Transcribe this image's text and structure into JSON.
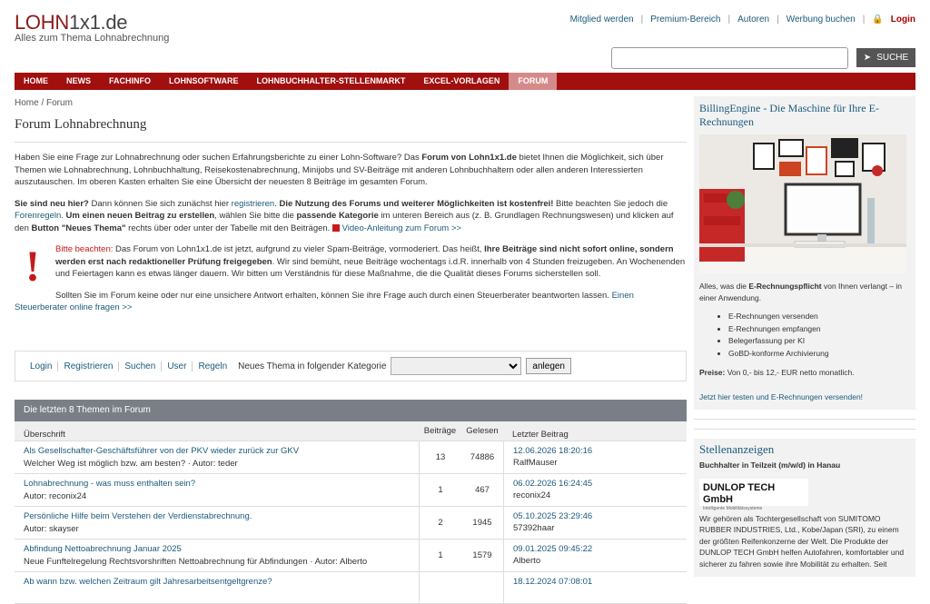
{
  "header": {
    "logo_a": "LOHN",
    "logo_b": "1x1.de",
    "tagline": "Alles zum Thema Lohnabrechnung",
    "links": [
      "Mitglied werden",
      "Premium-Bereich",
      "Autoren",
      "Werbung buchen"
    ],
    "login": "Login"
  },
  "search": {
    "button": "SUCHE",
    "placeholder": ""
  },
  "nav": [
    "HOME",
    "NEWS",
    "FACHINFO",
    "LOHNSOFTWARE",
    "LOHNBUCHHALTER-STELLENMARKT",
    "EXCEL-VORLAGEN",
    "FORUM"
  ],
  "breadcrumb": "Home / Forum",
  "page": {
    "title": "Forum Lohnabrechnung",
    "intro_a": "Haben Sie eine Frage zur Lohnabrechnung oder suchen Erfahrungsberichte zu einer Lohn-Software? Das ",
    "intro_b": "Forum von Lohn1x1.de",
    "intro_c": " bietet Ihnen die Möglichkeit, sich über Themen wie Lohnabrechnung, Lohnbuchhaltung, Reisekostenabrechnung, Minijobs und SV-Beiträge mit anderen Lohnbuchhaltern oder allen anderen Interessierten auszutauschen. Im oberen Kasten erhalten Sie eine Übersicht der neuesten 8 Beiträge im gesamten Forum.",
    "new_a": "Sie sind neu hier?",
    "new_b": " Dann können Sie sich zunächst hier ",
    "new_link": "registrieren",
    "new_c": ". ",
    "new_d": "Die Nutzung des Forums und weiterer Möglichkeiten ist kostenfrei!",
    "new_e": " Bitte beachten Sie jedoch die ",
    "new_rules": "Forenregeln",
    "new_f": ". ",
    "new_g": "Um einen neuen Beitrag zu erstellen",
    "new_h": ", wählen Sie bitte die ",
    "new_i": "passende Kategorie",
    "new_j": " im unteren Bereich aus (z. B. Grundlagen Rechnungswesen) und klicken auf den ",
    "new_k": "Button \"Neues Thema\"",
    "new_l": " rechts über oder unter der Tabelle mit den Beiträgen. ",
    "video": "Video-Anleitung zum Forum >>",
    "warn_a": "Bitte beachten:",
    "warn_b": " Das Forum von Lohn1x1.de ist jetzt, aufgrund zu vieler Spam-Beiträge, vormoderiert. Das heißt, ",
    "warn_c": "Ihre Beiträge sind nicht sofort online, sondern werden erst nach redaktioneller Prüfung freigegeben",
    "warn_d": ". Wir sind bemüht, neue Beiträge wochentags i.d.R. innerhalb von 4 Stunden freizugeben. An Wochenenden und Feiertagen kann es etwas länger dauern. Wir bitten um Verständnis für diese Maßnahme, die die Qualität dieses Forums sicherstellen soll.",
    "tax_a": "Sollten Sie im Forum keine oder nur eine unsichere Antwort erhalten, können Sie ihre Frage auch durch einen Steuerberater beantworten lassen.  ",
    "tax_link": "Einen Steuerberater online fragen  >>"
  },
  "actions": {
    "links": [
      "Login",
      "Registrieren",
      "Suchen",
      "User",
      "Regeln"
    ],
    "label": "Neues Thema in folgender Kategorie",
    "button": "anlegen"
  },
  "table": {
    "title": "Die letzten 8 Themen im Forum",
    "cols": [
      "Überschrift",
      "Beiträge",
      "Gelesen",
      "Letzter Beitrag"
    ],
    "rows": [
      {
        "t": "Als Gesellschafter-Geschäftsführer von der PKV wieder zurück zur GKV",
        "s": "Welcher Weg ist möglich bzw. am besten? · Autor: teder",
        "n": "13",
        "r": "74886",
        "d": "12.06.2026 18:20:16",
        "u": "RalfMauser"
      },
      {
        "t": "Lohnabrechnung - was muss enthalten sein?",
        "s": "Autor: reconix24",
        "n": "1",
        "r": "467",
        "d": "06.02.2026 16:24:45",
        "u": "reconix24"
      },
      {
        "t": "Persönliche Hilfe beim Verstehen der Verdienstabrechnung.",
        "s": "Autor: skayser",
        "n": "2",
        "r": "1945",
        "d": "05.10.2025 23:29:46",
        "u": "57392haar"
      },
      {
        "t": "Abfindung Nettoabrechnung Januar 2025",
        "s": "Neue Funftelregelung Rechtsvorshriften Nettoabrechnung für Abfindungen · Autor: Alberto",
        "n": "1",
        "r": "1579",
        "d": "09.01.2025 09:45:22",
        "u": "Alberto"
      },
      {
        "t": "Ab wann bzw. welchen Zeitraum gilt Jahresarbeitsentgeltgrenze?",
        "s": "",
        "n": "",
        "r": "",
        "d": "18.12.2024 07:08:01",
        "u": ""
      }
    ]
  },
  "sidebar": {
    "ad_title": "BillingEngine - Die Maschine für Ihre E-Rechnungen",
    "ad_text_a": "Alles, was die ",
    "ad_text_b": "E-Rechnungspflicht",
    "ad_text_c": " von Ihnen verlangt – in einer Anwendung.",
    "bullets": [
      "E-Rechnungen versenden",
      "E-Rechnungen empfangen",
      "Belegerfassung per KI",
      "GoBD-konforme Archivierung"
    ],
    "price_a": "Preise:",
    "price_b": " Von 0,- bis 12,- EUR netto monatlich.",
    "cta": "Jetzt hier testen und E-Rechnungen versenden!",
    "jobs_title": "Stellenanzeigen",
    "job": "Buchhalter in Teilzeit (m/w/d) in Hanau",
    "company": "DUNLOP TECH GmbH",
    "company_sub": "Intelligente Mobilitätssysteme",
    "job_text": "Wir gehören als Tochtergesellschaft von SUMITOMO RUBBER INDUSTRIES, Ltd., Kobe/Japan (SRI), zu einem der größten Reifenkonzerne der Welt. Die Produkte der DUNLOP TECH GmbH helfen Autofahren, komfortabler und sicherer zu fahren sowie ihre Mobilität zu erhalten. Seit"
  },
  "colors": {
    "brand": "#a20f0f",
    "link": "#1b5a7a",
    "active_nav": "#d58a8a"
  }
}
